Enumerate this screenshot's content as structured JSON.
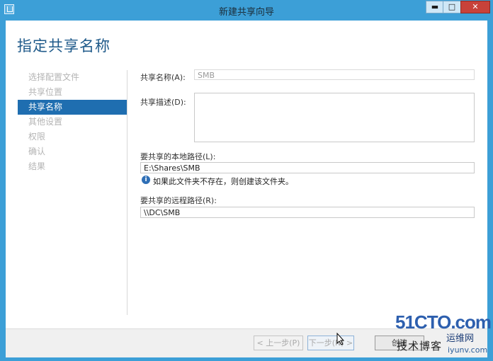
{
  "window": {
    "title": "新建共享向导",
    "controls": {
      "minimize": "▬",
      "maximize": "□",
      "close": "✕"
    }
  },
  "page": {
    "title": "指定共享名称"
  },
  "steps": [
    {
      "label": "选择配置文件",
      "active": false
    },
    {
      "label": "共享位置",
      "active": false
    },
    {
      "label": "共享名称",
      "active": true
    },
    {
      "label": "其他设置",
      "active": false
    },
    {
      "label": "权限",
      "active": false
    },
    {
      "label": "确认",
      "active": false
    },
    {
      "label": "结果",
      "active": false
    }
  ],
  "form": {
    "share_name_label": "共享名称(A):",
    "share_name_value": "SMB",
    "share_desc_label": "共享描述(D):",
    "share_desc_value": "",
    "local_path_label": "要共享的本地路径(L):",
    "local_path_value": "E:\\Shares\\SMB",
    "info_text": "如果此文件夹不存在，则创建该文件夹。",
    "remote_path_label": "要共享的远程路径(R):",
    "remote_path_value": "\\\\DC\\SMB"
  },
  "footer": {
    "prev_label": "< 上一步(P)",
    "next_label": "下一步(N) >",
    "create_label": "创建"
  },
  "watermark": {
    "main": "51CTO.com",
    "side": "运维网",
    "sub": "技术博客",
    "url": "iyunv.com"
  },
  "colors": {
    "titlebar": "#3c9fd7",
    "accent": "#1f6eb0",
    "page_title": "#1f5a8a",
    "close_button": "#c8423a"
  }
}
